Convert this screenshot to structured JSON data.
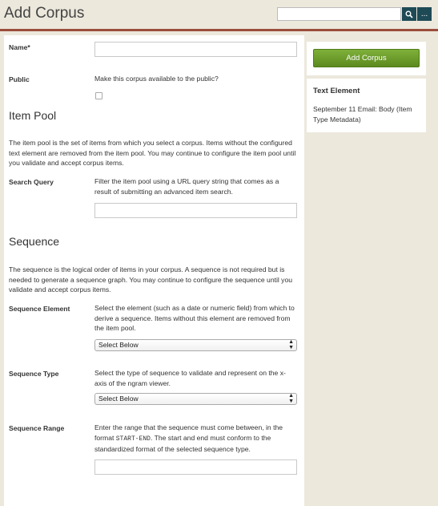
{
  "page_title": "Add Corpus",
  "search": {
    "placeholder": "",
    "adv_label": "..."
  },
  "form": {
    "name_label": "Name*",
    "public_label": "Public",
    "public_hint": "Make this corpus available to the public?",
    "item_pool": {
      "heading": "Item Pool",
      "description": "The item pool is the set of items from which you select a corpus. Items without the configured text element are removed from the item pool. You may continue to configure the item pool until you validate and accept corpus items.",
      "search_query_label": "Search Query",
      "search_query_hint": "Filter the item pool using a URL query string that comes as a result of submitting an advanced item search."
    },
    "sequence": {
      "heading": "Sequence",
      "description": "The sequence is the logical order of items in your corpus. A sequence is not required but is needed to generate a sequence graph. You may continue to configure the sequence until you validate and accept corpus items.",
      "element_label": "Sequence Element",
      "element_hint": "Select the element (such as a date or numeric field) from which to derive a sequence. Items without this element are removed from the item pool.",
      "element_select": "Select Below",
      "type_label": "Sequence Type",
      "type_hint": "Select the type of sequence to validate and represent on the x-axis of the ngram viewer.",
      "type_select": "Select Below",
      "range_label": "Sequence Range",
      "range_hint_1": "Enter the range that the sequence must come between, in the format",
      "range_hint_code": "START-END",
      "range_hint_2": ". The start and end must conform to the standardized format of the selected sequence type."
    }
  },
  "sidebar": {
    "add_button": "Add Corpus",
    "text_element_heading": "Text Element",
    "text_element_value": "September 11 Email: Body (Item Type Metadata)"
  },
  "colors": {
    "accent_bar": "#9c4d3b",
    "search_button": "#1e4a56",
    "add_button": "#6a9a28"
  },
  "icons": [
    "search-icon",
    "more-icon",
    "select-arrows-icon"
  ]
}
